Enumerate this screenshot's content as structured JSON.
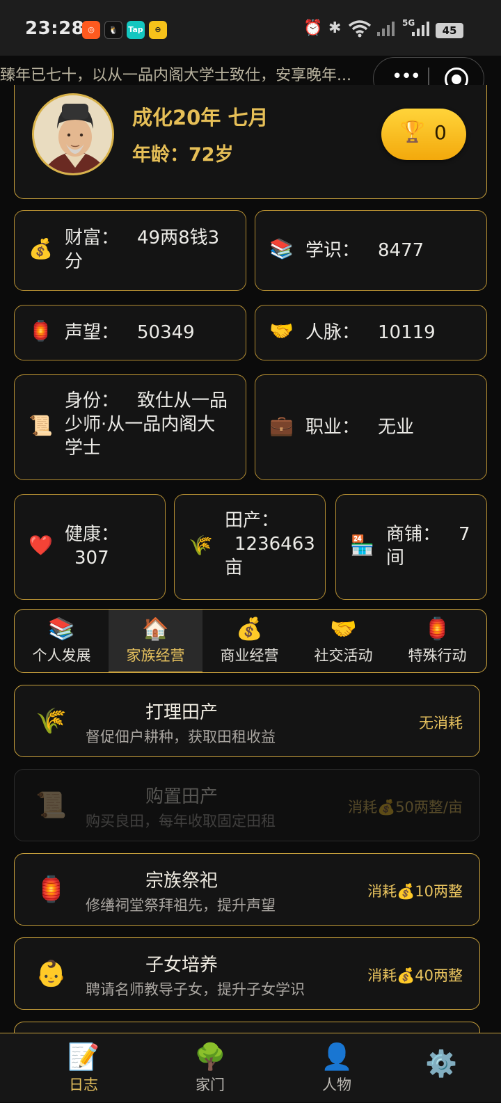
{
  "status_bar": {
    "time": "23:28",
    "network": "5G",
    "battery": "45"
  },
  "marquee": {
    "text": "臻年已七十，以从一品内阁大学士致仕，安享晚年..."
  },
  "header": {
    "date": "成化20年 七月",
    "age_label": "年龄：",
    "age_value": "72岁",
    "trophy_count": "0"
  },
  "stats": {
    "wealth": {
      "label": "财富：",
      "value": "49两8钱3",
      "value_cont": "分",
      "icon": "money-bag-icon"
    },
    "knowledge": {
      "label": "学识：",
      "value": "8477",
      "icon": "books-icon"
    },
    "prestige": {
      "label": "声望：",
      "value": "50349",
      "icon": "lantern-icon"
    },
    "connections": {
      "label": "人脉：",
      "value": "10119",
      "icon": "handshake-icon"
    },
    "identity": {
      "label": "身份：",
      "line1": "致仕从一品",
      "line2": "少师·从一品内阁大",
      "line3": "学士",
      "icon": "scroll-icon"
    },
    "occupation": {
      "label": "职业：",
      "value": "无业",
      "icon": "briefcase-icon"
    },
    "health": {
      "label": "健康：",
      "value": "307",
      "icon": "heart-icon"
    },
    "farmland": {
      "label": "田产：",
      "value": "1236463",
      "unit": "亩",
      "icon": "rice-icon"
    },
    "shops": {
      "label": "商铺：",
      "value": "7",
      "unit": "间",
      "icon": "store-icon"
    }
  },
  "tabs": [
    {
      "label": "个人发展",
      "icon": "books-icon"
    },
    {
      "label": "家族经营",
      "icon": "house-icon"
    },
    {
      "label": "商业经营",
      "icon": "money-bag-icon"
    },
    {
      "label": "社交活动",
      "icon": "handshake-icon"
    },
    {
      "label": "特殊行动",
      "icon": "lantern-icon"
    }
  ],
  "active_tab": "家族经营",
  "actions": [
    {
      "title": "打理田产",
      "desc": "督促佃户耕种，获取田租收益",
      "cost": "无消耗",
      "enabled": true,
      "icon": "rice-icon"
    },
    {
      "title": "购置田产",
      "desc": "购买良田，每年收取固定田租",
      "cost": "消耗💰50两整/亩",
      "enabled": false,
      "icon": "scroll-icon"
    },
    {
      "title": "宗族祭祀",
      "desc": "修缮祠堂祭拜祖先，提升声望",
      "cost": "消耗💰10两整",
      "enabled": true,
      "icon": "lantern-icon"
    },
    {
      "title": "子女培养",
      "desc": "聘请名师教导子女，提升子女学识",
      "cost": "消耗💰40两整",
      "enabled": true,
      "icon": "baby-icon"
    }
  ],
  "bottom_nav": [
    {
      "label": "日志",
      "icon": "memo-icon"
    },
    {
      "label": "家门",
      "icon": "tree-icon"
    },
    {
      "label": "人物",
      "icon": "person-icon"
    },
    {
      "label": "",
      "icon": "gear-icon"
    }
  ],
  "colors": {
    "accent_gold": "#e6bf57",
    "border_gold": "#c9a13c",
    "background": "#0b0b0b",
    "card": "#141414"
  }
}
